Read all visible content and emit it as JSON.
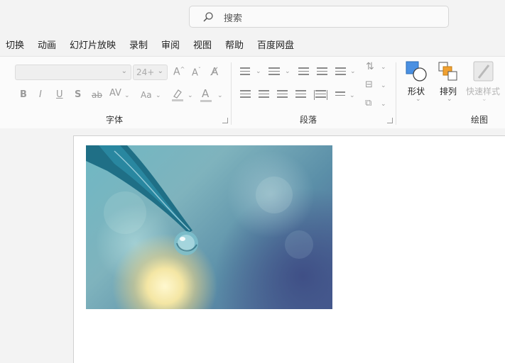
{
  "search": {
    "placeholder": "搜索",
    "icon": "search-icon"
  },
  "menu": {
    "tabs": [
      "切换",
      "动画",
      "幻灯片放映",
      "录制",
      "审阅",
      "视图",
      "帮助",
      "百度网盘"
    ]
  },
  "ribbon": {
    "font_group": {
      "label": "字体",
      "font_name": "",
      "font_size": "24+",
      "grow_label": "A",
      "shrink_label": "A",
      "bold": "B",
      "italic": "I",
      "underline": "U",
      "shadow": "S",
      "strike": "ab",
      "spacing": "AV",
      "case": "Aa",
      "font_color": "A"
    },
    "paragraph_group": {
      "label": "段落"
    },
    "drawing_group": {
      "label": "绘图",
      "shapes": "形状",
      "arrange": "排列",
      "quick_styles": "快速样式"
    }
  },
  "colors": {
    "accent": "#2b79d6",
    "orange": "#e8a23a",
    "disabled": "#b5b5b5"
  }
}
